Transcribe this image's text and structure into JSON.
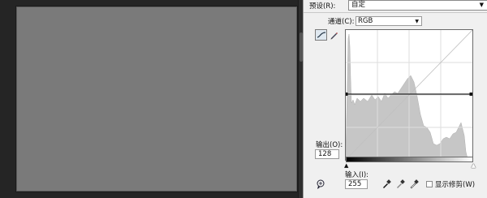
{
  "dialog": {
    "preset_label": "预设(R):",
    "preset_value": "自定",
    "channel_label": "通道(C):",
    "channel_value": "RGB",
    "output_label": "输出(O):",
    "output_value": "128",
    "input_label": "输入(I):",
    "input_value": "255",
    "show_clipping_label": "显示修剪(W)",
    "show_clipping_checked": false
  },
  "icons": {
    "curve_tool": "curve-icon",
    "pencil_tool": "pencil-icon",
    "black_eyedropper": "eyedropper-black-icon",
    "gray_eyedropper": "eyedropper-gray-icon",
    "white_eyedropper": "eyedropper-white-icon",
    "target_adjust": "hand-target-icon"
  },
  "colors": {
    "canvas_bg": "#252525",
    "document": "#7a7a7a",
    "dialog_bg": "#f0f0f0",
    "histogram": "#c6c6c6"
  }
}
